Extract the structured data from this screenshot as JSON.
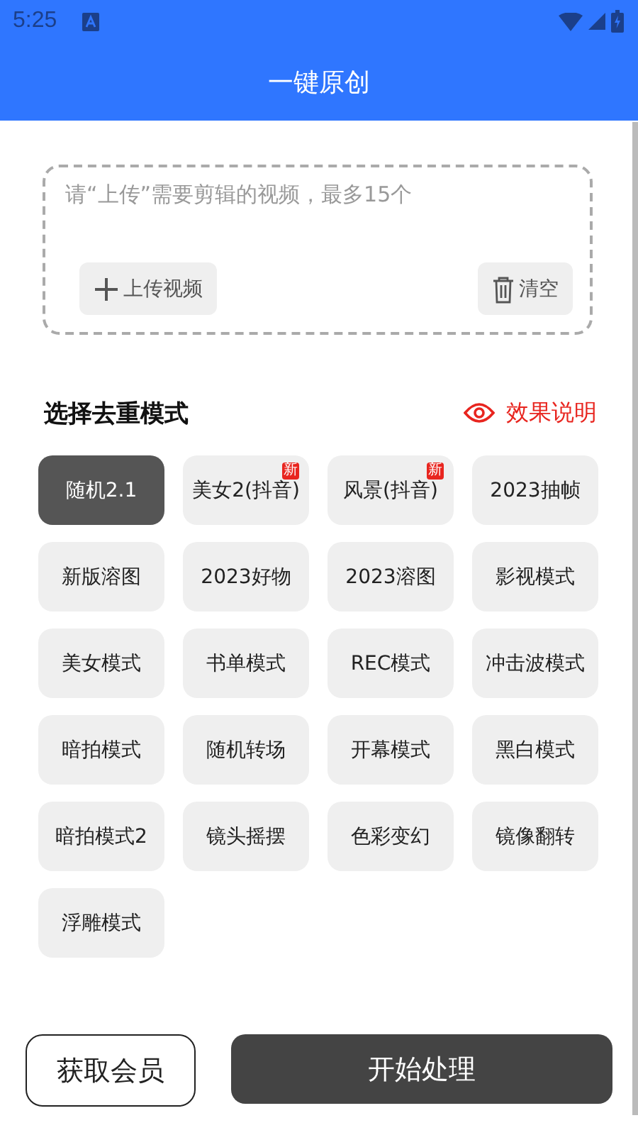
{
  "status_bar": {
    "time": "5:25"
  },
  "app_bar": {
    "title": "一键原创"
  },
  "upload": {
    "placeholder": "请“上传”需要剪辑的视频，最多15个",
    "upload_button": "上传视频",
    "clear_button": "清空"
  },
  "mode_section": {
    "title": "选择去重模式",
    "help_link": "效果说明"
  },
  "modes": [
    {
      "label": "随机2.1",
      "selected": true
    },
    {
      "label": "美女2(抖音)",
      "selected": false,
      "badge": "新"
    },
    {
      "label": "风景(抖音)",
      "selected": false,
      "badge": "新"
    },
    {
      "label": "2023抽帧",
      "selected": false
    },
    {
      "label": "新版溶图",
      "selected": false
    },
    {
      "label": "2023好物",
      "selected": false
    },
    {
      "label": "2023溶图",
      "selected": false
    },
    {
      "label": "影视模式",
      "selected": false
    },
    {
      "label": "美女模式",
      "selected": false
    },
    {
      "label": "书单模式",
      "selected": false
    },
    {
      "label": "REC模式",
      "selected": false
    },
    {
      "label": "冲击波模式",
      "selected": false
    },
    {
      "label": "暗拍模式",
      "selected": false
    },
    {
      "label": "随机转场",
      "selected": false
    },
    {
      "label": "开幕模式",
      "selected": false
    },
    {
      "label": "黑白模式",
      "selected": false
    },
    {
      "label": "暗拍模式2",
      "selected": false
    },
    {
      "label": "镜头摇摆",
      "selected": false
    },
    {
      "label": "色彩变幻",
      "selected": false
    },
    {
      "label": "镜像翻转",
      "selected": false
    },
    {
      "label": "浮雕模式",
      "selected": false
    }
  ],
  "bottom_bar": {
    "member_button": "获取会员",
    "start_button": "开始处理"
  }
}
